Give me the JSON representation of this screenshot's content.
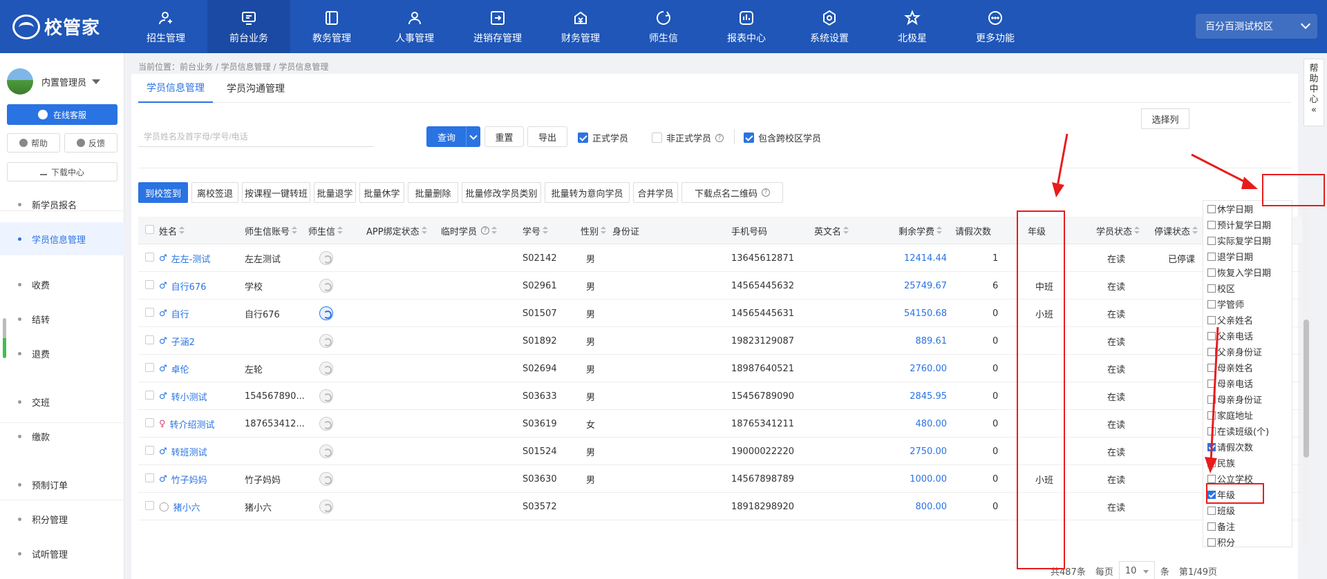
{
  "app": {
    "logo_text": "校管家",
    "campus": "百分百测试校区"
  },
  "nav": [
    {
      "label": "招生管理",
      "icon": "user-add-icon"
    },
    {
      "label": "前台业务",
      "icon": "monitor-icon",
      "active": true
    },
    {
      "label": "教务管理",
      "icon": "book-icon"
    },
    {
      "label": "人事管理",
      "icon": "person-icon"
    },
    {
      "label": "进销存管理",
      "icon": "exchange-icon"
    },
    {
      "label": "财务管理",
      "icon": "money-bag-icon"
    },
    {
      "label": "师生信",
      "icon": "chat-icon"
    },
    {
      "label": "报表中心",
      "icon": "chart-icon"
    },
    {
      "label": "系统设置",
      "icon": "gear-icon"
    },
    {
      "label": "北极星",
      "icon": "star-icon"
    },
    {
      "label": "更多功能",
      "icon": "more-icon"
    }
  ],
  "sidebar": {
    "user_name": "内置管理员",
    "service_label": "在线客服",
    "help_label": "帮助",
    "feedback_label": "反馈",
    "download_label": "下载中心",
    "items": [
      {
        "label": "新学员报名"
      },
      {
        "label": "学员信息管理",
        "active": true
      },
      {
        "label": "收费"
      },
      {
        "label": "结转"
      },
      {
        "label": "退费"
      },
      {
        "label": "交班"
      },
      {
        "label": "缴款"
      },
      {
        "label": "预制订单"
      },
      {
        "label": "积分管理"
      },
      {
        "label": "试听管理"
      }
    ]
  },
  "breadcrumb": "当前位置：前台业务 / 学员信息管理 / 学员信息管理",
  "tabs": [
    {
      "label": "学员信息管理",
      "active": true
    },
    {
      "label": "学员沟通管理"
    }
  ],
  "search": {
    "placeholder": "学员姓名及首字母/学号/电话",
    "query_label": "查询",
    "reset_label": "重置",
    "export_label": "导出",
    "formal_label": "正式学员",
    "informal_label": "非正式学员",
    "cross_campus_label": "包含跨校区学员"
  },
  "actions": [
    {
      "label": "到校签到",
      "primary": true
    },
    {
      "label": "离校签退"
    },
    {
      "label": "按课程一键转班"
    },
    {
      "label": "批量退学"
    },
    {
      "label": "批量休学"
    },
    {
      "label": "批量删除"
    },
    {
      "label": "批量修改学员类别"
    },
    {
      "label": "批量转为意向学员"
    },
    {
      "label": "合并学员"
    },
    {
      "label": "下载点名二维码"
    }
  ],
  "select_columns_label": "选择列",
  "columns": [
    "姓名",
    "师生信账号",
    "师生信",
    "APP绑定状态",
    "临时学员",
    "学号",
    "性别",
    "身份证",
    "手机号码",
    "英文名",
    "剩余学费",
    "请假次数",
    "年级",
    "学员状态",
    "停课状态"
  ],
  "rows": [
    {
      "name": "左左-测试",
      "gender": "m",
      "account": "左左测试",
      "wx": false,
      "id": "S02142",
      "sex": "男",
      "phone": "13645612871",
      "fee": "12414.44",
      "leave": "1",
      "grade": "",
      "status": "在读",
      "stop": "已停课"
    },
    {
      "name": "自行676",
      "gender": "m",
      "account": "学校",
      "wx": false,
      "id": "S02961",
      "sex": "男",
      "phone": "14565445632",
      "fee": "25749.67",
      "leave": "6",
      "grade": "中班",
      "status": "在读",
      "stop": ""
    },
    {
      "name": "自行",
      "gender": "m",
      "account": "自行676",
      "wx": true,
      "id": "S01507",
      "sex": "男",
      "phone": "14565445631",
      "fee": "54150.68",
      "leave": "0",
      "grade": "小班",
      "status": "在读",
      "stop": ""
    },
    {
      "name": "子涵2",
      "gender": "m",
      "account": "",
      "wx": false,
      "id": "S01892",
      "sex": "男",
      "phone": "19823129087",
      "fee": "889.61",
      "leave": "0",
      "grade": "",
      "status": "在读",
      "stop": ""
    },
    {
      "name": "卓伦",
      "gender": "m",
      "account": "左轮",
      "wx": false,
      "id": "S02694",
      "sex": "男",
      "phone": "18987640521",
      "fee": "2760.00",
      "leave": "0",
      "grade": "",
      "status": "在读",
      "stop": ""
    },
    {
      "name": "转小测试",
      "gender": "m",
      "account": "154567890...",
      "wx": false,
      "id": "S03633",
      "sex": "男",
      "phone": "15456789090",
      "fee": "2845.95",
      "leave": "0",
      "grade": "",
      "status": "在读",
      "stop": ""
    },
    {
      "name": "转介绍测试",
      "gender": "f",
      "account": "187653412...",
      "wx": false,
      "id": "S03619",
      "sex": "女",
      "phone": "18765341211",
      "fee": "480.00",
      "leave": "0",
      "grade": "",
      "status": "在读",
      "stop": ""
    },
    {
      "name": "转班测试",
      "gender": "m",
      "account": "",
      "wx": false,
      "id": "S01524",
      "sex": "男",
      "phone": "19000022220",
      "fee": "2750.00",
      "leave": "0",
      "grade": "",
      "status": "在读",
      "stop": ""
    },
    {
      "name": "竹子妈妈",
      "gender": "m",
      "account": "竹子妈妈",
      "wx": false,
      "id": "S03630",
      "sex": "男",
      "phone": "14567898789",
      "fee": "1000.00",
      "leave": "0",
      "grade": "小班",
      "status": "在读",
      "stop": ""
    },
    {
      "name": "猪小六",
      "gender": "n",
      "account": "猪小六",
      "wx": false,
      "id": "S03572",
      "sex": "",
      "phone": "18918298920",
      "fee": "800.00",
      "leave": "0",
      "grade": "",
      "status": "在读",
      "stop": ""
    }
  ],
  "pager": {
    "total": "共487条",
    "per_page_label": "每页",
    "per_page": "10",
    "unit": "条",
    "page": "第1/49页"
  },
  "column_options": [
    {
      "label": "休学日期",
      "checked": false
    },
    {
      "label": "预计复学日期",
      "checked": false
    },
    {
      "label": "实际复学日期",
      "checked": false
    },
    {
      "label": "退学日期",
      "checked": false
    },
    {
      "label": "恢复入学日期",
      "checked": false
    },
    {
      "label": "校区",
      "checked": false
    },
    {
      "label": "学管师",
      "checked": false
    },
    {
      "label": "父亲姓名",
      "checked": false
    },
    {
      "label": "父亲电话",
      "checked": false
    },
    {
      "label": "父亲身份证",
      "checked": false
    },
    {
      "label": "母亲姓名",
      "checked": false
    },
    {
      "label": "母亲电话",
      "checked": false
    },
    {
      "label": "母亲身份证",
      "checked": false
    },
    {
      "label": "家庭地址",
      "checked": false
    },
    {
      "label": "在读班级(个)",
      "checked": false
    },
    {
      "label": "请假次数",
      "checked": true
    },
    {
      "label": "民族",
      "checked": false
    },
    {
      "label": "公立学校",
      "checked": false
    },
    {
      "label": "年级",
      "checked": true
    },
    {
      "label": "班级",
      "checked": false
    },
    {
      "label": "备注",
      "checked": false
    },
    {
      "label": "积分",
      "checked": false
    }
  ],
  "help_tab": [
    "帮",
    "助",
    "中",
    "心",
    "«"
  ],
  "colors": {
    "brand": "#1f56b7",
    "accent": "#2a73e3",
    "annotation": "#e81c1c"
  }
}
